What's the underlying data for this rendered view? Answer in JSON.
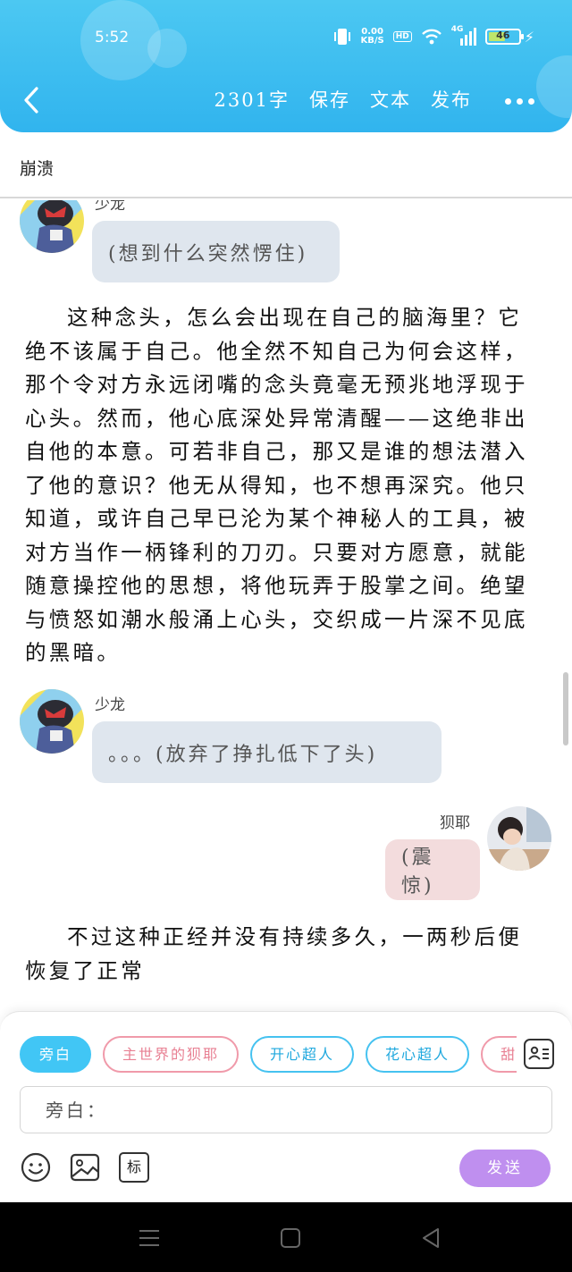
{
  "status_bar": {
    "time": "5:52",
    "net_speed_value": "0.00",
    "net_speed_unit": "KB/S",
    "hd_label": "HD",
    "network_label": "4G",
    "battery_level": "46"
  },
  "toolbar": {
    "word_count": "2301字",
    "save_label": "保存",
    "text_label": "文本",
    "publish_label": "发布"
  },
  "doc": {
    "title": "崩溃"
  },
  "content": {
    "msg1": {
      "speaker": "少龙",
      "text": "(想到什么突然愣住)"
    },
    "narration1": "这种念头，怎么会出现在自己的脑海里？它绝不该属于自己。他全然不知自己为何会这样，那个令对方永远闭嘴的念头竟毫无预兆地浮现于心头。然而，他心底深处异常清醒——这绝非出自他的本意。可若非自己，那又是谁的想法潜入了他的意识？他无从得知，也不想再深究。他只知道，或许自己早已沦为某个神秘人的工具，被对方当作一柄锋利的刀刃。只要对方愿意，就能随意操控他的思想，将他玩弄于股掌之间。绝望与愤怒如潮水般涌上心头，交织成一片深不见底的黑暗。",
    "msg2": {
      "speaker": "少龙",
      "text": "。。。(放弃了挣扎低下了头)"
    },
    "msg3": {
      "speaker": "狈耶",
      "text": "(震惊)"
    },
    "narration2": "不过这种正经并没有持续多久，一两秒后便恢复了正常"
  },
  "composer": {
    "chips": [
      "旁白",
      "主世界的狈耶",
      "开心超人",
      "花心超人",
      "甜心超人"
    ],
    "input_placeholder": "旁白：",
    "tag_button_label": "标",
    "send_label": "发送"
  },
  "colors": {
    "header": "#31b4ee",
    "send_button": "#bf8fef",
    "active_chip": "#41c6f5"
  }
}
